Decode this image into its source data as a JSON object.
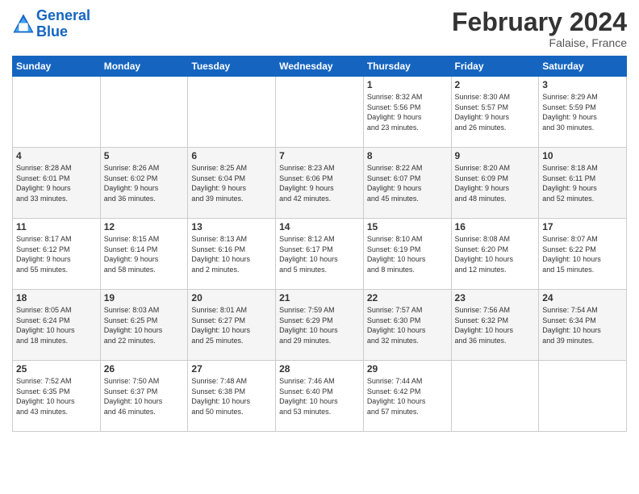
{
  "header": {
    "logo_line1": "General",
    "logo_line2": "Blue",
    "month": "February 2024",
    "location": "Falaise, France"
  },
  "days_of_week": [
    "Sunday",
    "Monday",
    "Tuesday",
    "Wednesday",
    "Thursday",
    "Friday",
    "Saturday"
  ],
  "weeks": [
    [
      {
        "day": "",
        "info": ""
      },
      {
        "day": "",
        "info": ""
      },
      {
        "day": "",
        "info": ""
      },
      {
        "day": "",
        "info": ""
      },
      {
        "day": "1",
        "info": "Sunrise: 8:32 AM\nSunset: 5:56 PM\nDaylight: 9 hours\nand 23 minutes."
      },
      {
        "day": "2",
        "info": "Sunrise: 8:30 AM\nSunset: 5:57 PM\nDaylight: 9 hours\nand 26 minutes."
      },
      {
        "day": "3",
        "info": "Sunrise: 8:29 AM\nSunset: 5:59 PM\nDaylight: 9 hours\nand 30 minutes."
      }
    ],
    [
      {
        "day": "4",
        "info": "Sunrise: 8:28 AM\nSunset: 6:01 PM\nDaylight: 9 hours\nand 33 minutes."
      },
      {
        "day": "5",
        "info": "Sunrise: 8:26 AM\nSunset: 6:02 PM\nDaylight: 9 hours\nand 36 minutes."
      },
      {
        "day": "6",
        "info": "Sunrise: 8:25 AM\nSunset: 6:04 PM\nDaylight: 9 hours\nand 39 minutes."
      },
      {
        "day": "7",
        "info": "Sunrise: 8:23 AM\nSunset: 6:06 PM\nDaylight: 9 hours\nand 42 minutes."
      },
      {
        "day": "8",
        "info": "Sunrise: 8:22 AM\nSunset: 6:07 PM\nDaylight: 9 hours\nand 45 minutes."
      },
      {
        "day": "9",
        "info": "Sunrise: 8:20 AM\nSunset: 6:09 PM\nDaylight: 9 hours\nand 48 minutes."
      },
      {
        "day": "10",
        "info": "Sunrise: 8:18 AM\nSunset: 6:11 PM\nDaylight: 9 hours\nand 52 minutes."
      }
    ],
    [
      {
        "day": "11",
        "info": "Sunrise: 8:17 AM\nSunset: 6:12 PM\nDaylight: 9 hours\nand 55 minutes."
      },
      {
        "day": "12",
        "info": "Sunrise: 8:15 AM\nSunset: 6:14 PM\nDaylight: 9 hours\nand 58 minutes."
      },
      {
        "day": "13",
        "info": "Sunrise: 8:13 AM\nSunset: 6:16 PM\nDaylight: 10 hours\nand 2 minutes."
      },
      {
        "day": "14",
        "info": "Sunrise: 8:12 AM\nSunset: 6:17 PM\nDaylight: 10 hours\nand 5 minutes."
      },
      {
        "day": "15",
        "info": "Sunrise: 8:10 AM\nSunset: 6:19 PM\nDaylight: 10 hours\nand 8 minutes."
      },
      {
        "day": "16",
        "info": "Sunrise: 8:08 AM\nSunset: 6:20 PM\nDaylight: 10 hours\nand 12 minutes."
      },
      {
        "day": "17",
        "info": "Sunrise: 8:07 AM\nSunset: 6:22 PM\nDaylight: 10 hours\nand 15 minutes."
      }
    ],
    [
      {
        "day": "18",
        "info": "Sunrise: 8:05 AM\nSunset: 6:24 PM\nDaylight: 10 hours\nand 18 minutes."
      },
      {
        "day": "19",
        "info": "Sunrise: 8:03 AM\nSunset: 6:25 PM\nDaylight: 10 hours\nand 22 minutes."
      },
      {
        "day": "20",
        "info": "Sunrise: 8:01 AM\nSunset: 6:27 PM\nDaylight: 10 hours\nand 25 minutes."
      },
      {
        "day": "21",
        "info": "Sunrise: 7:59 AM\nSunset: 6:29 PM\nDaylight: 10 hours\nand 29 minutes."
      },
      {
        "day": "22",
        "info": "Sunrise: 7:57 AM\nSunset: 6:30 PM\nDaylight: 10 hours\nand 32 minutes."
      },
      {
        "day": "23",
        "info": "Sunrise: 7:56 AM\nSunset: 6:32 PM\nDaylight: 10 hours\nand 36 minutes."
      },
      {
        "day": "24",
        "info": "Sunrise: 7:54 AM\nSunset: 6:34 PM\nDaylight: 10 hours\nand 39 minutes."
      }
    ],
    [
      {
        "day": "25",
        "info": "Sunrise: 7:52 AM\nSunset: 6:35 PM\nDaylight: 10 hours\nand 43 minutes."
      },
      {
        "day": "26",
        "info": "Sunrise: 7:50 AM\nSunset: 6:37 PM\nDaylight: 10 hours\nand 46 minutes."
      },
      {
        "day": "27",
        "info": "Sunrise: 7:48 AM\nSunset: 6:38 PM\nDaylight: 10 hours\nand 50 minutes."
      },
      {
        "day": "28",
        "info": "Sunrise: 7:46 AM\nSunset: 6:40 PM\nDaylight: 10 hours\nand 53 minutes."
      },
      {
        "day": "29",
        "info": "Sunrise: 7:44 AM\nSunset: 6:42 PM\nDaylight: 10 hours\nand 57 minutes."
      },
      {
        "day": "",
        "info": ""
      },
      {
        "day": "",
        "info": ""
      }
    ]
  ]
}
